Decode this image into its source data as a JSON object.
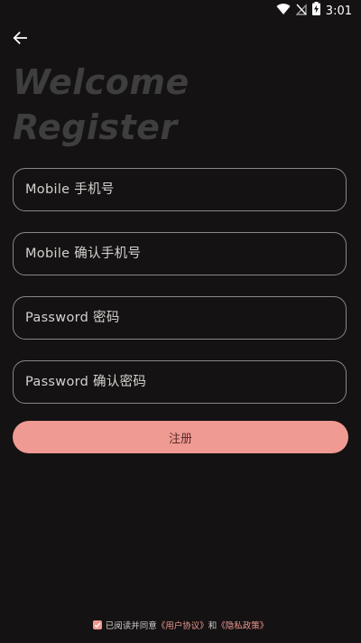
{
  "status_bar": {
    "time": "3:01",
    "icons": [
      "wifi-icon",
      "no-signal-icon",
      "battery-charging-icon"
    ]
  },
  "header": {
    "back_icon": "arrow-left-icon",
    "title_line1": "Welcome",
    "title_line2": "Register"
  },
  "form": {
    "mobile_placeholder": "Mobile 手机号",
    "mobile_confirm_placeholder": "Mobile 确认手机号",
    "password_placeholder": "Password 密码",
    "password_confirm_placeholder": "Password 确认密码",
    "register_label": "注册"
  },
  "agreement": {
    "checked": true,
    "prefix": "已阅读并同意",
    "user_agreement": "《用户协议》",
    "conjunction": "和",
    "privacy_policy": "《隐私政策》"
  },
  "colors": {
    "background": "#141212",
    "accent": "#ef9a92",
    "field_border": "#8c8686",
    "headline": "#3f3e3e"
  }
}
